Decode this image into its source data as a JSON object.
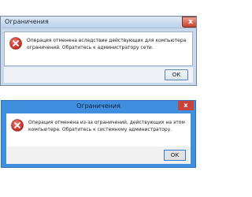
{
  "dialog1": {
    "title": "Ограничения",
    "close_label": "x",
    "message": "Операция отменена вследствие действующих для компьютера ограничений. Обратитесь к администратору сети.",
    "ok_label": "ОК",
    "icon": "error-icon"
  },
  "dialog2": {
    "title": "Ограничения",
    "close_label": "x",
    "message": "Операция отменена из-за ограничений, действующих на этом компьютере. Обратитесь к системному администратору.",
    "ok_label": "ОК",
    "icon": "error-icon"
  },
  "colors": {
    "error_red": "#d8332b",
    "win8_blue": "#3f8fde",
    "win7_frame": "#c7d8ec"
  }
}
